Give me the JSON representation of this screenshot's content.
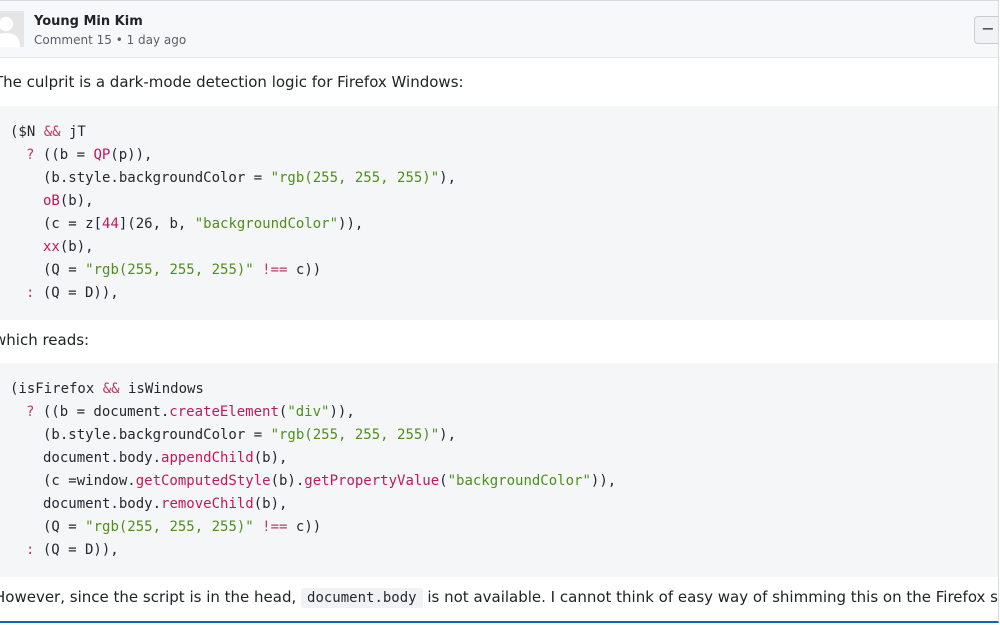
{
  "comment": {
    "author": "Young Min Kim",
    "meta": "Comment 15 • 1 day ago",
    "collapse_label": "−",
    "intro": "The culprit is a dark-mode detection logic for Firefox Windows:",
    "code_minified": {
      "l1_a": "($N ",
      "l1_op": "&&",
      "l1_b": " jT",
      "l2_q": "? ",
      "l2_a": "((b = ",
      "l2_fn": "QP",
      "l2_b": "(p)),",
      "l3_a": "(b.style.backgroundColor = ",
      "l3_str": "\"rgb(255, 255, 255)\"",
      "l3_b": "),",
      "l4_fn": "oB",
      "l4_b": "(b),",
      "l5_a": "(c = z[",
      "l5_num": "44",
      "l5_b": "](26, b, ",
      "l5_str": "\"backgroundColor\"",
      "l5_c": ")),",
      "l6_fn": "xx",
      "l6_b": "(b),",
      "l7_a": "(Q = ",
      "l7_str": "\"rgb(255, 255, 255)\"",
      "l7_op": " !== ",
      "l7_b": "c))",
      "l8_c": ": ",
      "l8_a": "(Q = D)),"
    },
    "reads": "which reads:",
    "code_readable": {
      "l1_a": "(isFirefox ",
      "l1_op": "&&",
      "l1_b": " isWindows",
      "l2_q": "? ",
      "l2_a": "((b = document.",
      "l2_fn": "createElement",
      "l2_b": "(",
      "l2_str": "\"div\"",
      "l2_c": ")),",
      "l3_a": "(b.style.backgroundColor = ",
      "l3_str": "\"rgb(255, 255, 255)\"",
      "l3_b": "),",
      "l4_a": "document.body.",
      "l4_fn": "appendChild",
      "l4_b": "(b),",
      "l5_a": "(c =window.",
      "l5_fn": "getComputedStyle",
      "l5_b": "(b).",
      "l5_fn2": "getPropertyValue",
      "l5_c": "(",
      "l5_str": "\"backgroundColor\"",
      "l5_d": ")),",
      "l6_a": "document.body.",
      "l6_fn": "removeChild",
      "l6_b": "(b),",
      "l7_a": "(Q = ",
      "l7_str": "\"rgb(255, 255, 255)\"",
      "l7_op": " !== ",
      "l7_b": "c))",
      "l8_c": ": ",
      "l8_a": "(Q = D)),"
    },
    "outro_a": "However, since the script is in the head, ",
    "outro_code": "document.body",
    "outro_b": " is not available. I cannot think of easy way of shimming this on the Firefox side."
  },
  "colors": {
    "accent_border": "#0a66c2",
    "keyword": "#b93a68",
    "string": "#4e8f1c",
    "code_bg": "#f5f6f7"
  }
}
